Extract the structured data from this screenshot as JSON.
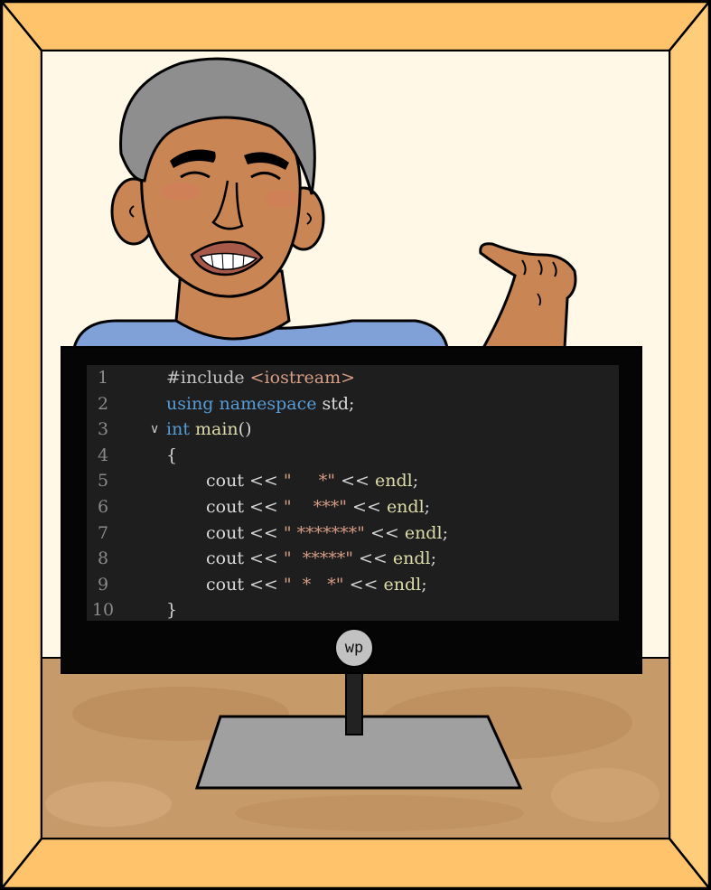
{
  "logo": {
    "text": "wp"
  },
  "editor": {
    "lines": [
      {
        "num": "1",
        "indent": 0,
        "fold": "",
        "tokens": [
          {
            "t": "#include ",
            "c": "pre"
          },
          {
            "t": "<iostream>",
            "c": "hdr"
          }
        ]
      },
      {
        "num": "2",
        "indent": 0,
        "fold": "",
        "tokens": [
          {
            "t": "using",
            "c": "kw"
          },
          {
            "t": " ",
            "c": "p"
          },
          {
            "t": "namespace",
            "c": "kw"
          },
          {
            "t": " std;",
            "c": "id"
          }
        ]
      },
      {
        "num": "3",
        "indent": 0,
        "fold": "v",
        "tokens": [
          {
            "t": "int",
            "c": "kw"
          },
          {
            "t": " ",
            "c": "p"
          },
          {
            "t": "main",
            "c": "fn"
          },
          {
            "t": "()",
            "c": "p"
          }
        ]
      },
      {
        "num": "4",
        "indent": 0,
        "fold": "",
        "tokens": [
          {
            "t": "{",
            "c": "p"
          }
        ]
      },
      {
        "num": "5",
        "indent": 1,
        "fold": "",
        "tokens": [
          {
            "t": "cout",
            "c": "id"
          },
          {
            "t": " << ",
            "c": "p"
          },
          {
            "t": "\"     *\"",
            "c": "str"
          },
          {
            "t": " << ",
            "c": "p"
          },
          {
            "t": "endl",
            "c": "fn"
          },
          {
            "t": ";",
            "c": "p"
          }
        ]
      },
      {
        "num": "6",
        "indent": 1,
        "fold": "",
        "tokens": [
          {
            "t": "cout",
            "c": "id"
          },
          {
            "t": " << ",
            "c": "p"
          },
          {
            "t": "\"    ***\"",
            "c": "str"
          },
          {
            "t": " << ",
            "c": "p"
          },
          {
            "t": "endl",
            "c": "fn"
          },
          {
            "t": ";",
            "c": "p"
          }
        ]
      },
      {
        "num": "7",
        "indent": 1,
        "fold": "",
        "tokens": [
          {
            "t": "cout",
            "c": "id"
          },
          {
            "t": " << ",
            "c": "p"
          },
          {
            "t": "\" *******\"",
            "c": "str"
          },
          {
            "t": " << ",
            "c": "p"
          },
          {
            "t": "endl",
            "c": "fn"
          },
          {
            "t": ";",
            "c": "p"
          }
        ]
      },
      {
        "num": "8",
        "indent": 1,
        "fold": "",
        "tokens": [
          {
            "t": "cout",
            "c": "id"
          },
          {
            "t": " << ",
            "c": "p"
          },
          {
            "t": "\"  *****\"",
            "c": "str"
          },
          {
            "t": " << ",
            "c": "p"
          },
          {
            "t": "endl",
            "c": "fn"
          },
          {
            "t": ";",
            "c": "p"
          }
        ]
      },
      {
        "num": "9",
        "indent": 1,
        "fold": "",
        "tokens": [
          {
            "t": "cout",
            "c": "id"
          },
          {
            "t": " << ",
            "c": "p"
          },
          {
            "t": "\"  *   *\"",
            "c": "str"
          },
          {
            "t": " << ",
            "c": "p"
          },
          {
            "t": "endl",
            "c": "fn"
          },
          {
            "t": ";",
            "c": "p"
          }
        ]
      },
      {
        "num": "10",
        "indent": 0,
        "fold": "",
        "tokens": [
          {
            "t": "}",
            "c": "p"
          }
        ]
      }
    ]
  }
}
